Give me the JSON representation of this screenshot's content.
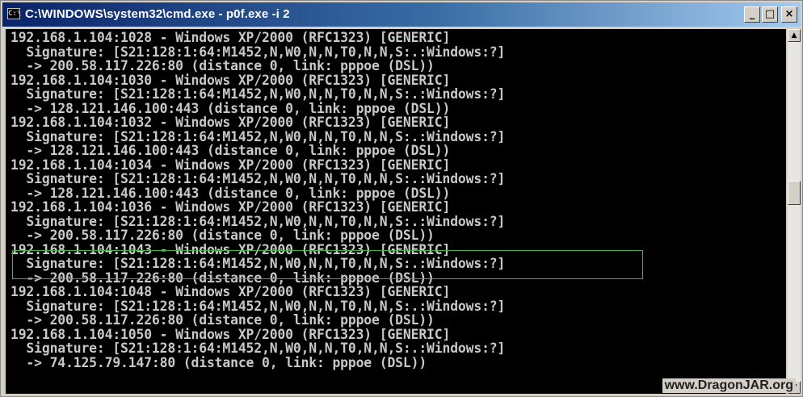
{
  "window": {
    "title": "C:\\WINDOWS\\system32\\cmd.exe - p0f.exe -i 2",
    "icon_label": "C:\\",
    "controls": {
      "minimize": "_",
      "maximize": "□",
      "close": "×"
    }
  },
  "console": {
    "lines": [
      "192.168.1.104:1028 - Windows XP/2000 (RFC1323) [GENERIC]",
      "  Signature: [S21:128:1:64:M1452,N,W0,N,N,T0,N,N,S:.:Windows:?]",
      "  -> 200.58.117.226:80 (distance 0, link: pppoe (DSL))",
      "192.168.1.104:1030 - Windows XP/2000 (RFC1323) [GENERIC]",
      "  Signature: [S21:128:1:64:M1452,N,W0,N,N,T0,N,N,S:.:Windows:?]",
      "  -> 128.121.146.100:443 (distance 0, link: pppoe (DSL))",
      "192.168.1.104:1032 - Windows XP/2000 (RFC1323) [GENERIC]",
      "  Signature: [S21:128:1:64:M1452,N,W0,N,N,T0,N,N,S:.:Windows:?]",
      "  -> 128.121.146.100:443 (distance 0, link: pppoe (DSL))",
      "192.168.1.104:1034 - Windows XP/2000 (RFC1323) [GENERIC]",
      "  Signature: [S21:128:1:64:M1452,N,W0,N,N,T0,N,N,S:.:Windows:?]",
      "  -> 128.121.146.100:443 (distance 0, link: pppoe (DSL))",
      "192.168.1.104:1036 - Windows XP/2000 (RFC1323) [GENERIC]",
      "  Signature: [S21:128:1:64:M1452,N,W0,N,N,T0,N,N,S:.:Windows:?]",
      "  -> 200.58.117.226:80 (distance 0, link: pppoe (DSL))",
      "192.168.1.104:1043 - Windows XP/2000 (RFC1323) [GENERIC]",
      "  Signature: [S21:128:1:64:M1452,N,W0,N,N,T0,N,N,S:.:Windows:?]",
      "  -> 200.58.117.226:80 (distance 0, link: pppoe (DSL))",
      "192.168.1.104:1048 - Windows XP/2000 (RFC1323) [GENERIC]",
      "  Signature: [S21:128:1:64:M1452,N,W0,N,N,T0,N,N,S:.:Windows:?]",
      "  -> 200.58.117.226:80 (distance 0, link: pppoe (DSL))",
      "192.168.1.104:1050 - Windows XP/2000 (RFC1323) [GENERIC]",
      "  Signature: [S21:128:1:64:M1452,N,W0,N,N,T0,N,N,S:.:Windows:?]",
      "  -> 74.125.79.147:80 (distance 0, link: pppoe (DSL))"
    ]
  },
  "watermark": "www.DragonJAR.org",
  "colors": {
    "text": "#c8c8c8",
    "background": "#000000",
    "highlight": "#3fb43f",
    "titlebar": "#0a246a"
  }
}
